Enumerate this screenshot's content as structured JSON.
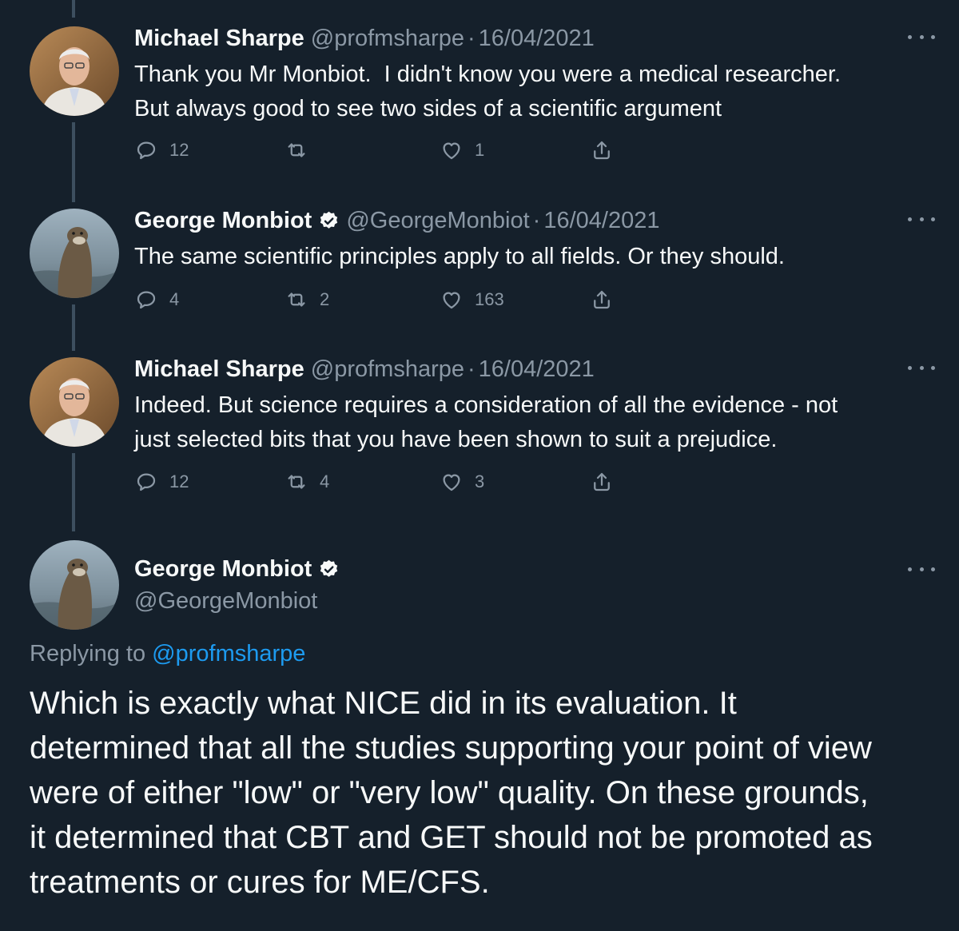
{
  "users": {
    "sharpe": {
      "name": "Michael Sharpe",
      "handle": "@profmsharpe"
    },
    "monbiot": {
      "name": "George Monbiot",
      "handle": "@GeorgeMonbiot"
    }
  },
  "separator": "·",
  "tweets": [
    {
      "name": "Michael Sharpe",
      "handle": "@profmsharpe",
      "date": "16/04/2021",
      "lines": [
        "Thank you Mr Monbiot.  I didn't know you were a medical researcher.",
        "But always good to see two sides of a scientific argument"
      ],
      "replies": "12",
      "retweets": "",
      "likes": "1"
    },
    {
      "name": "George Monbiot",
      "handle": "@GeorgeMonbiot",
      "date": "16/04/2021",
      "lines": [
        "The same scientific principles apply to all fields. Or they should."
      ],
      "replies": "4",
      "retweets": "2",
      "likes": "163"
    },
    {
      "name": "Michael Sharpe",
      "handle": "@profmsharpe",
      "date": "16/04/2021",
      "lines": [
        "Indeed. But science requires a consideration of all the evidence - not",
        "just selected bits that you have been shown to suit a prejudice."
      ],
      "replies": "12",
      "retweets": "4",
      "likes": "3"
    }
  ],
  "main_tweet": {
    "name": "George Monbiot",
    "handle": "@GeorgeMonbiot",
    "replying_prefix": "Replying to",
    "replying_mention": "@profmsharpe",
    "lines": [
      "Which is exactly what NICE did in its evaluation. It",
      "determined that all the studies supporting your point of view",
      "were of either \"low\" or \"very low\" quality. On these grounds,",
      "it determined that CBT and GET should not be promoted as",
      "treatments or cures for ME/CFS."
    ]
  },
  "colors": {
    "background": "#15202b",
    "text": "#f7f9f9",
    "secondary": "#8b98a5",
    "link": "#1d9bf0",
    "thread_line": "#3d4f5f"
  }
}
